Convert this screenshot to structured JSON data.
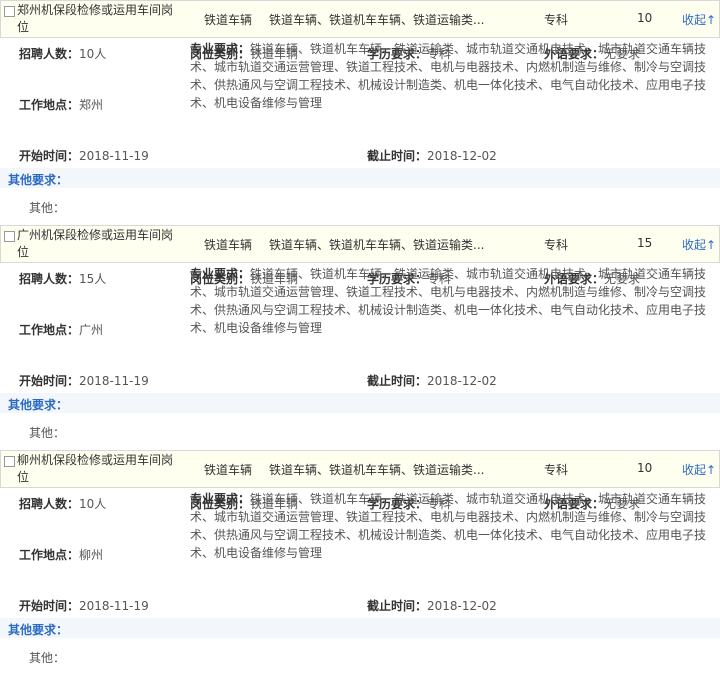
{
  "labels": {
    "hire_count": "招聘人数：",
    "category": "岗位类别：",
    "education": "学历要求：",
    "language": "外语要求：",
    "major": "专业要求：",
    "location": "工作地点：",
    "start": "开始时间：",
    "end": "截止时间：",
    "other_req": "其他要求：",
    "other": "其他："
  },
  "jobs": [
    {
      "title": "郑州机保段检修或运用车间岗位",
      "category": "铁道车辆",
      "major_short": "铁道车辆、铁道机车车辆、铁道运输类",
      "education": "专科",
      "count": "10",
      "toggle": "收起↑",
      "hire_count": "10人",
      "category_value": "铁道车辆",
      "education_value": "专科",
      "language_value": "无要求",
      "major_value": "铁道车辆、铁道机车车辆、铁道运输类、城市轨道交通机电技术、城市轨道交通车辆技术、城市轨道交通运营管理、铁道工程技术、电机与电器技术、内燃机制造与维修、制冷与空调技术、供热通风与空调工程技术、机械设计制造类、机电一体化技术、电气自动化技术、应用电子技术、机电设备维修与管理",
      "location_value": "郑州",
      "start_value": "2018-11-19",
      "end_value": "2018-12-02"
    },
    {
      "title": "广州机保段检修或运用车间岗位",
      "category": "铁道车辆",
      "major_short": "铁道车辆、铁道机车车辆、铁道运输类",
      "education": "专科",
      "count": "15",
      "toggle": "收起↑",
      "hire_count": "15人",
      "category_value": "铁道车辆",
      "education_value": "专科",
      "language_value": "无要求",
      "major_value": "铁道车辆、铁道机车车辆、铁道运输类、城市轨道交通机电技术、城市轨道交通车辆技术、城市轨道交通运营管理、铁道工程技术、电机与电器技术、内燃机制造与维修、制冷与空调技术、供热通风与空调工程技术、机械设计制造类、机电一体化技术、电气自动化技术、应用电子技术、机电设备维修与管理",
      "location_value": "广州",
      "start_value": "2018-11-19",
      "end_value": "2018-12-02"
    },
    {
      "title": "柳州机保段检修或运用车间岗位",
      "category": "铁道车辆",
      "major_short": "铁道车辆、铁道机车车辆、铁道运输类",
      "education": "专科",
      "count": "10",
      "toggle": "收起↑",
      "hire_count": "10人",
      "category_value": "铁道车辆",
      "education_value": "专科",
      "language_value": "无要求",
      "major_value": "铁道车辆、铁道机车车辆、铁道运输类、城市轨道交通机电技术、城市轨道交通车辆技术、城市轨道交通运营管理、铁道工程技术、电机与电器技术、内燃机制造与维修、制冷与空调技术、供热通风与空调工程技术、机械设计制造类、机电一体化技术、电气自动化技术、应用电子技术、机电设备维修与管理",
      "location_value": "柳州",
      "start_value": "2018-11-19",
      "end_value": "2018-12-02"
    }
  ]
}
